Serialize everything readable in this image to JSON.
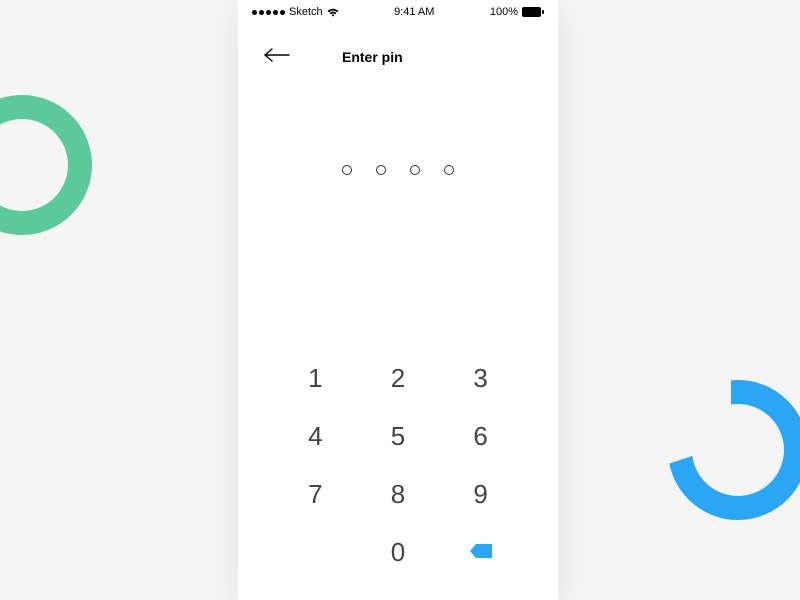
{
  "status_bar": {
    "carrier": "Sketch",
    "time": "9:41 AM",
    "battery": "100%"
  },
  "header": {
    "title": "Enter pin"
  },
  "pin": {
    "length": 4,
    "entered": 0
  },
  "keypad": {
    "keys": [
      "1",
      "2",
      "3",
      "4",
      "5",
      "6",
      "7",
      "8",
      "9",
      "0"
    ]
  },
  "colors": {
    "accent_green": "#5cc99a",
    "accent_blue": "#2ba6f5"
  }
}
